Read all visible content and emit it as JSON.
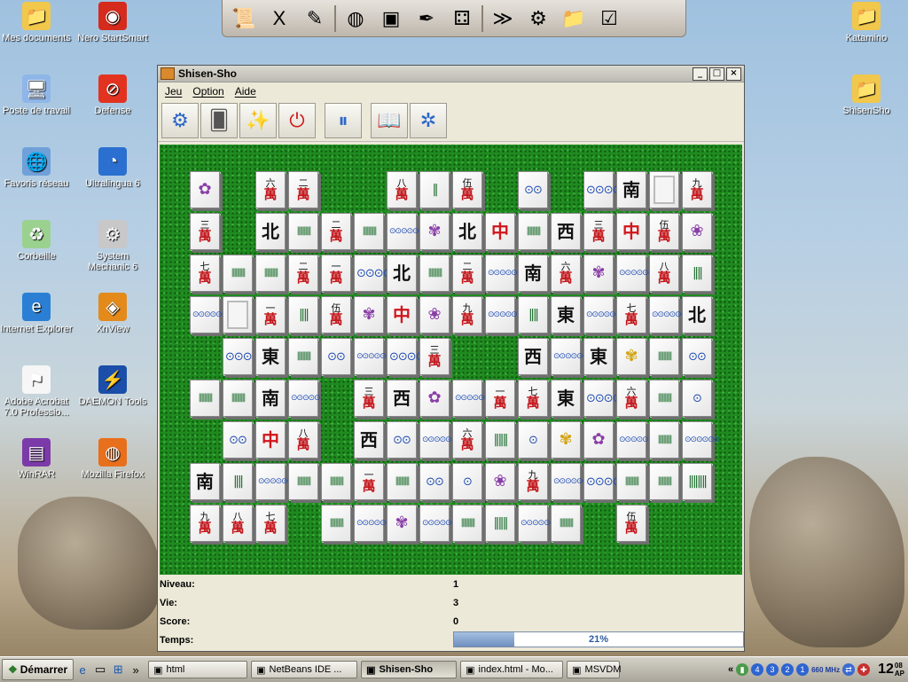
{
  "desktop": {
    "icons_left": [
      {
        "label": "Mes documents",
        "icon": "folder-documents-icon",
        "glyph": "📁",
        "bg": "#f1c84b"
      },
      {
        "label": "Nero StartSmart",
        "icon": "nero-icon",
        "glyph": "◉",
        "bg": "#d42b1c"
      },
      {
        "label": "Poste de travail",
        "icon": "computer-icon",
        "glyph": "🖥",
        "bg": "#8fb6e8"
      },
      {
        "label": "Defense",
        "icon": "no-entry-icon",
        "glyph": "⊘",
        "bg": "#e23320"
      },
      {
        "label": "Favoris réseau",
        "icon": "network-icon",
        "glyph": "🌐",
        "bg": "#6fa0d8"
      },
      {
        "label": "Ultralingua 6",
        "icon": "ultralingua-icon",
        "glyph": "◔",
        "bg": "#2b6fd0"
      },
      {
        "label": "Corbeille",
        "icon": "recycle-bin-icon",
        "glyph": "♻",
        "bg": "#9bd18e"
      },
      {
        "label": "System Mechanic 6",
        "icon": "gear-icon",
        "glyph": "⚙",
        "bg": "#c8c8c8"
      },
      {
        "label": "Internet Explorer",
        "icon": "internet-explorer-icon",
        "glyph": "e",
        "bg": "#2a7fd4"
      },
      {
        "label": "XnView",
        "icon": "xnview-icon",
        "glyph": "◈",
        "bg": "#e38a1b"
      },
      {
        "label": "Adobe Acrobat 7.0 Professio...",
        "icon": "acrobat-icon",
        "glyph": "⚑",
        "bg": "#f6f6f6"
      },
      {
        "label": "DAEMON Tools",
        "icon": "daemon-tools-icon",
        "glyph": "⚡",
        "bg": "#1a4ea8"
      },
      {
        "label": "WinRAR",
        "icon": "winrar-icon",
        "glyph": "▤",
        "bg": "#7c3aa8"
      },
      {
        "label": "Mozilla Firefox",
        "icon": "firefox-icon",
        "glyph": "◍",
        "bg": "#e86f1c"
      }
    ],
    "icons_right": [
      {
        "label": "Katamino",
        "icon": "folder-icon",
        "glyph": "📁",
        "bg": "#f1c84b"
      },
      {
        "label": "ShisenSho",
        "icon": "folder-icon",
        "glyph": "📁",
        "bg": "#f1c84b"
      }
    ]
  },
  "quickbar": [
    {
      "icon": "certificate-icon",
      "glyph": "📜"
    },
    {
      "icon": "x-icon",
      "glyph": "X"
    },
    {
      "icon": "notepad-icon",
      "glyph": "✎"
    },
    {
      "icon": "sep"
    },
    {
      "icon": "firefox-icon",
      "glyph": "◍"
    },
    {
      "icon": "box-icon",
      "glyph": "▣"
    },
    {
      "icon": "drawing-icon",
      "glyph": "✒"
    },
    {
      "icon": "dice-icon",
      "glyph": "⚃"
    },
    {
      "icon": "sep"
    },
    {
      "icon": "terminal-icon",
      "glyph": "≫"
    },
    {
      "icon": "control-panel-icon",
      "glyph": "⚙"
    },
    {
      "icon": "folder-icon",
      "glyph": "📁"
    },
    {
      "icon": "checklist-icon",
      "glyph": "☑"
    }
  ],
  "window": {
    "title": "Shisen-Sho",
    "buttons": {
      "minimize": "_",
      "maximize": "□",
      "close": "×"
    },
    "menu": [
      "Jeu",
      "Option",
      "Aide"
    ],
    "toolbar": [
      {
        "name": "settings-button",
        "glyph": "⚙",
        "color": "#2a66c9"
      },
      {
        "name": "new-game-button",
        "glyph": "🂠",
        "color": "#555"
      },
      {
        "name": "hint-wand-button",
        "glyph": "✨",
        "color": "#c99a14"
      },
      {
        "name": "stop-button",
        "glyph": "⏻",
        "color": "#d01818"
      },
      {
        "sep": true
      },
      {
        "name": "pause-button",
        "glyph": "⏸",
        "color": "#2a66c9"
      },
      {
        "sep": true
      },
      {
        "name": "help-book-button",
        "glyph": "📖",
        "color": "#2a66c9"
      },
      {
        "name": "scores-button",
        "glyph": "✲",
        "color": "#2a66c9"
      }
    ]
  },
  "board": {
    "tiles": [
      [
        "F",
        "",
        "c6",
        "c2",
        "",
        "",
        "c8",
        "b1",
        "c5",
        "",
        "d2",
        "",
        "d4",
        "S",
        "P",
        "c9"
      ],
      [
        "c3",
        "",
        "N",
        "b9",
        "c2",
        "b6",
        "d9",
        "F",
        "N",
        "RD",
        "b9",
        "W",
        "c3",
        "RD",
        "c5",
        "F"
      ],
      [
        "c7",
        "b5",
        "b6",
        "c2",
        "c1",
        "d4",
        "N",
        "b9",
        "c2",
        "d6",
        "S",
        "c6",
        "F",
        "d6",
        "c8",
        "b2"
      ],
      [
        "d7",
        "P",
        "c1",
        "b2",
        "c5",
        "F",
        "RD",
        "F",
        "c9",
        "d5",
        "b2",
        "E",
        "d6",
        "c7",
        "d7",
        "N"
      ],
      [
        "",
        "d3",
        "E",
        "b5",
        "d2",
        "d7",
        "d4",
        "c3",
        "",
        "",
        "W",
        "d6",
        "E",
        "F",
        "b6",
        "d2"
      ],
      [
        "b5",
        "b6",
        "S",
        "d5",
        "",
        "c3",
        "W",
        "F",
        "d9",
        "c1",
        "c7",
        "E",
        "d4",
        "c6",
        "b6",
        "d1"
      ],
      [
        "",
        "d2",
        "RD",
        "c8",
        "",
        "W",
        "d2",
        "d5",
        "c6",
        "b3",
        "d1",
        "F",
        "F",
        "d5",
        "b9",
        "d6"
      ],
      [
        "S",
        "b2",
        "d6",
        "b5",
        "b7",
        "c1",
        "b9",
        "d2",
        "d1",
        "F",
        "c9",
        "d6",
        "d4",
        "b7",
        "b6",
        "b4"
      ],
      [
        "c9",
        "c8",
        "c7",
        "",
        "b6",
        "d7",
        "F",
        "d6",
        "b7",
        "b3",
        "d6",
        "b7",
        "",
        "c5",
        "",
        ""
      ]
    ]
  },
  "status": {
    "niveau_label": "Niveau:",
    "niveau_value": "1",
    "vie_label": "Vie:",
    "vie_value": "3",
    "score_label": "Score:",
    "score_value": "0",
    "temps_label": "Temps:",
    "temps_percent": "21%",
    "temps_fraction": 0.21
  },
  "taskbar": {
    "start_label": "Démarrer",
    "quick": [
      "ie-icon",
      "desktop-icon",
      "windows-icon",
      "explorer-icon"
    ],
    "tasks": [
      {
        "label": "html",
        "icon": "folder-icon",
        "active": false
      },
      {
        "label": "NetBeans IDE ...",
        "icon": "netbeans-icon",
        "active": false
      },
      {
        "label": "Shisen-Sho",
        "icon": "shisensho-icon",
        "active": true
      },
      {
        "label": "index.html - Mo...",
        "icon": "firefox-icon",
        "active": false
      },
      {
        "label": "MSVDM",
        "icon": "msvdm-icon",
        "active": false
      }
    ],
    "tray_digits": [
      "1",
      "2",
      "3",
      "4"
    ],
    "cpu": "660 MHz",
    "clock_hour": "12",
    "clock_min": "08",
    "clock_ampm": "AP"
  }
}
